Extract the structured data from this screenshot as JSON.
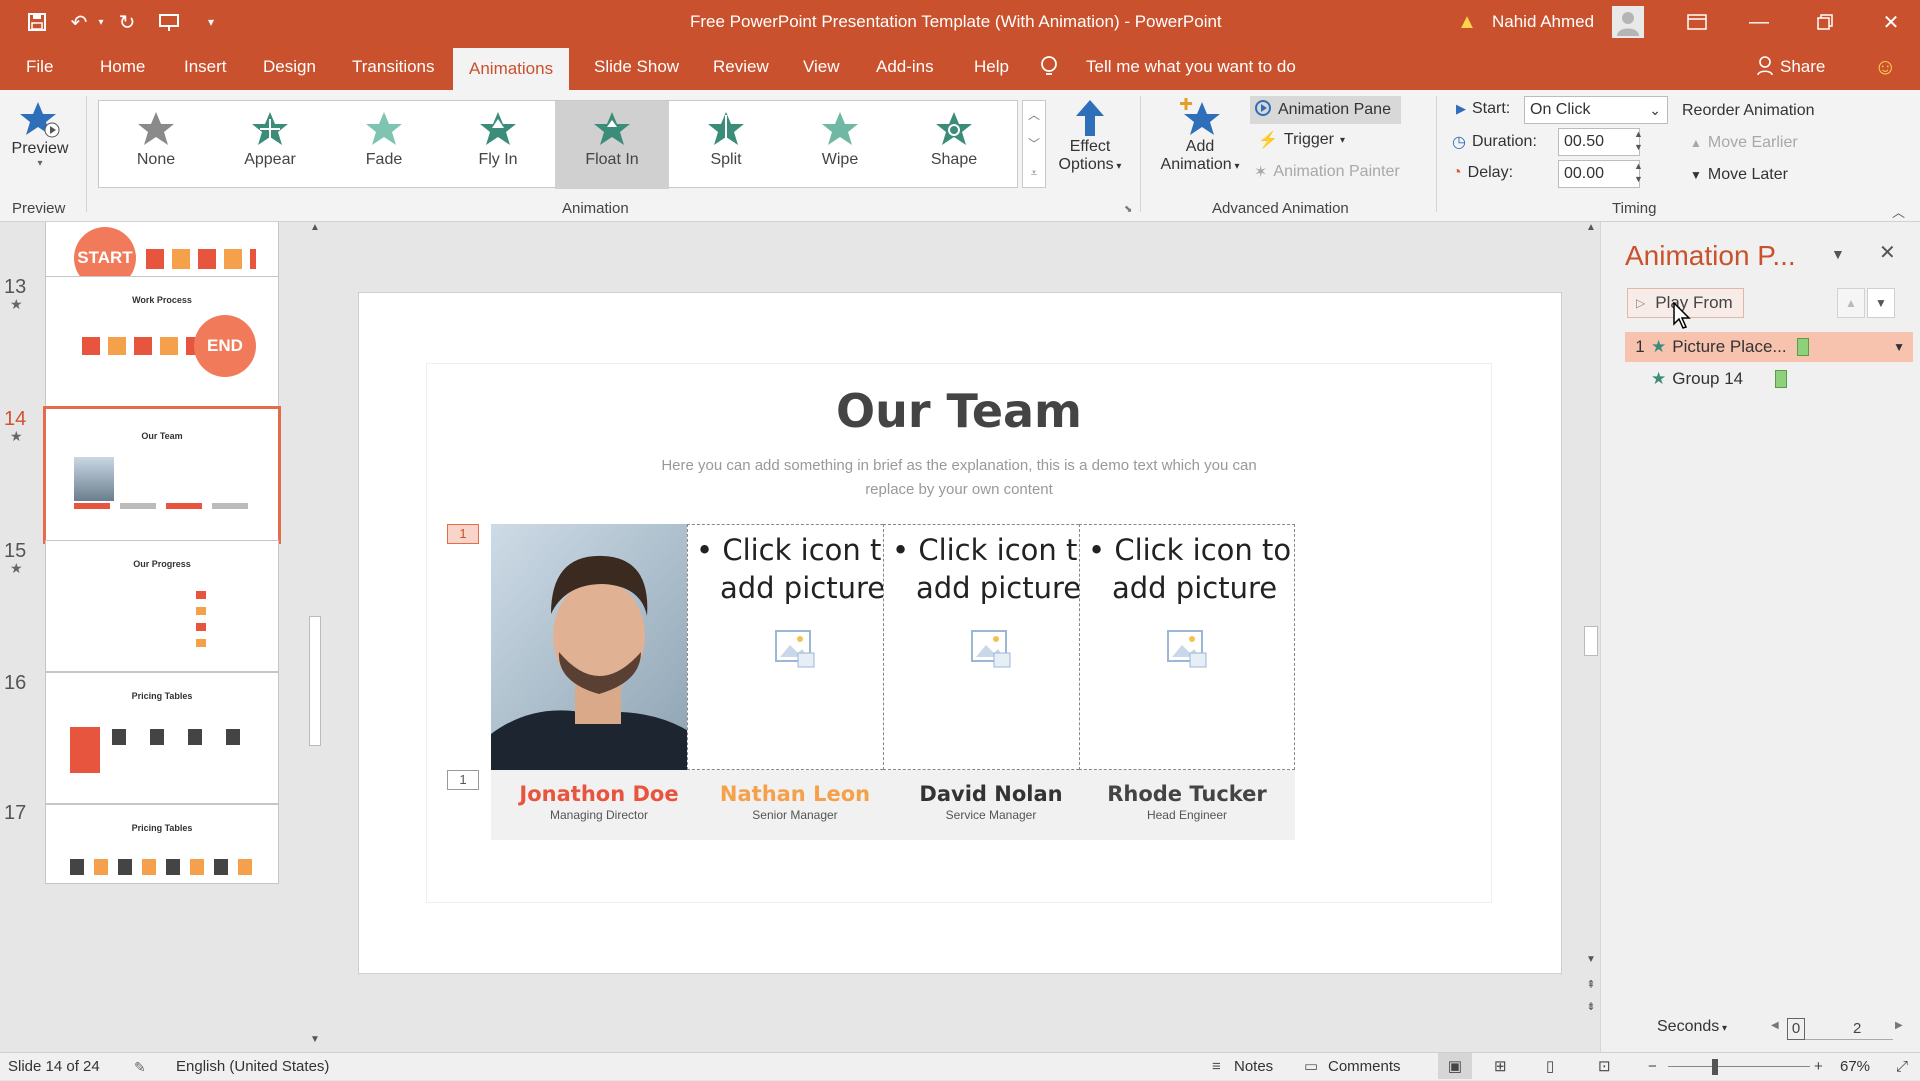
{
  "titlebar": {
    "title": "Free PowerPoint Presentation Template (With Animation)  -  PowerPoint",
    "user": "Nahid Ahmed",
    "warning_icon": "warning-icon"
  },
  "tabs": [
    "File",
    "Home",
    "Insert",
    "Design",
    "Transitions",
    "Animations",
    "Slide Show",
    "Review",
    "View",
    "Add-ins",
    "Help"
  ],
  "active_tab": "Animations",
  "tell_me": "Tell me what you want to do",
  "share": "Share",
  "ribbon": {
    "preview": {
      "label": "Preview",
      "group": "Preview"
    },
    "animation_gallery": [
      "None",
      "Appear",
      "Fade",
      "Fly In",
      "Float In",
      "Split",
      "Wipe",
      "Shape"
    ],
    "selected_animation": "Float In",
    "effect_options_1": "Effect",
    "effect_options_2": "Options",
    "group_animation": "Animation",
    "add_animation_1": "Add",
    "add_animation_2": "Animation",
    "animation_pane": "Animation Pane",
    "trigger": "Trigger",
    "animation_painter": "Animation Painter",
    "group_advanced": "Advanced Animation",
    "start_label": "Start:",
    "start_value": "On Click",
    "duration_label": "Duration:",
    "duration_value": "00.50",
    "delay_label": "Delay:",
    "delay_value": "00.00",
    "reorder": "Reorder Animation",
    "move_earlier": "Move Earlier",
    "move_later": "Move Later",
    "group_timing": "Timing"
  },
  "thumbnails": {
    "numbers": [
      "13",
      "14",
      "15",
      "16",
      "17"
    ],
    "titles": [
      "Work Process",
      "Our Team",
      "Our Progress",
      "Pricing Tables",
      "Pricing Tables"
    ],
    "top_badge": "START",
    "end_badge": "END"
  },
  "slide": {
    "title": "Our Team",
    "subtitle_1": "Here you can add something in brief as the explanation, this is a demo text which you can",
    "subtitle_2": "replace by your own content",
    "anim_tag_1": "1",
    "anim_tag_2": "1",
    "members": [
      {
        "name": "Jonathon Doe",
        "role": "Managing Director",
        "color": "#e8553e"
      },
      {
        "name": "Nathan Leon",
        "role": "Senior Manager",
        "color": "#f5a04a"
      },
      {
        "name": "David Nolan",
        "role": "Service Manager",
        "color": "#333333"
      },
      {
        "name": "Rhode Tucker",
        "role": "Head Engineer",
        "color": "#444444"
      }
    ],
    "placeholder_line_1": "• Click icon to",
    "placeholder_line_2": "add picture"
  },
  "pane": {
    "title": "Animation P...",
    "play_from": "Play From",
    "items": [
      {
        "num": "1",
        "label": "Picture Place..."
      },
      {
        "num": "",
        "label": "Group 14"
      }
    ],
    "seconds": "Seconds",
    "timeline_start": "0",
    "timeline_end": "2"
  },
  "status": {
    "slide_info": "Slide 14 of 24",
    "language": "English (United States)",
    "notes": "Notes",
    "comments": "Comments",
    "zoom": "67%"
  },
  "colors": {
    "accent": "#c9512d",
    "selection": "#e46c4a"
  }
}
